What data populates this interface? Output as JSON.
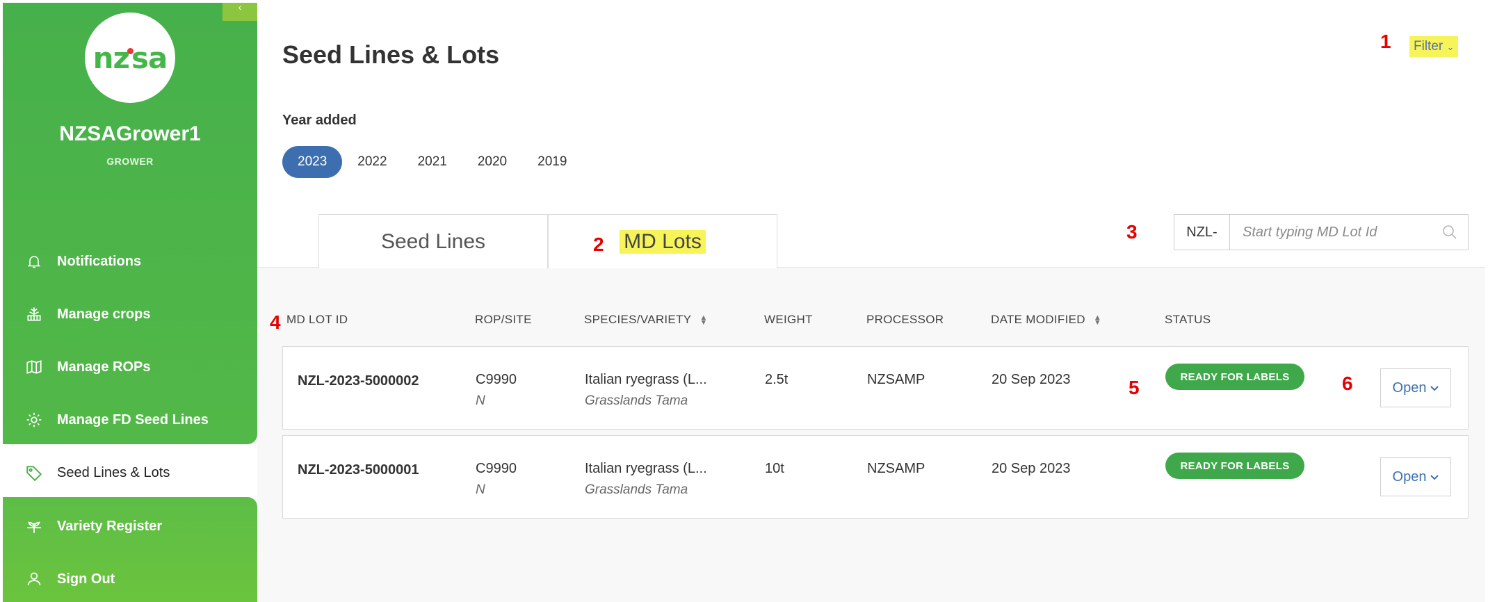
{
  "sidebar": {
    "corner_tab_glyph": "‹",
    "logo_text_left": "nz",
    "logo_text_right": "sa",
    "user_name": "NZSAGrower1",
    "user_role": "GROWER",
    "items": [
      {
        "label": "Notifications",
        "icon": "bell-icon"
      },
      {
        "label": "Manage crops",
        "icon": "crop-icon"
      },
      {
        "label": "Manage ROPs",
        "icon": "map-icon"
      },
      {
        "label": "Manage FD Seed Lines",
        "icon": "gear-icon"
      },
      {
        "label": "Seed Lines & Lots",
        "icon": "tag-icon",
        "active": true
      },
      {
        "label": "Variety Register",
        "icon": "sprout-icon"
      },
      {
        "label": "Sign Out",
        "icon": "user-icon"
      }
    ],
    "colors": {
      "green": "#46b04a",
      "light_green": "#8cc63f"
    }
  },
  "main": {
    "title": "Seed Lines & Lots",
    "filter_label": "Filter",
    "year_label": "Year added",
    "years": [
      "2023",
      "2022",
      "2021",
      "2020",
      "2019"
    ],
    "selected_year": "2023",
    "tabs": [
      {
        "label": "Seed Lines"
      },
      {
        "label": "MD Lots",
        "active": true
      }
    ],
    "search": {
      "prefix": "NZL-",
      "placeholder": "Start typing MD Lot Id"
    },
    "columns": [
      "MD LOT ID",
      "ROP/SITE",
      "SPECIES/VARIETY",
      "WEIGHT",
      "PROCESSOR",
      "DATE MODIFIED",
      "STATUS"
    ],
    "rows": [
      {
        "id": "NZL-2023-5000002",
        "rop": "C9990",
        "site": "N",
        "species": "Italian ryegrass (L...",
        "variety": "Grasslands Tama",
        "weight": "2.5t",
        "processor": "NZSAMP",
        "date": "20 Sep 2023",
        "status": "READY FOR LABELS",
        "action": "Open"
      },
      {
        "id": "NZL-2023-5000001",
        "rop": "C9990",
        "site": "N",
        "species": "Italian ryegrass (L...",
        "variety": "Grasslands Tama",
        "weight": "10t",
        "processor": "NZSAMP",
        "date": "20 Sep 2023",
        "status": "READY FOR LABELS",
        "action": "Open"
      }
    ],
    "accent": "#3d6fb0",
    "status_color": "#3fa84a"
  },
  "annotations": [
    "1",
    "2",
    "3",
    "4",
    "5",
    "6"
  ]
}
